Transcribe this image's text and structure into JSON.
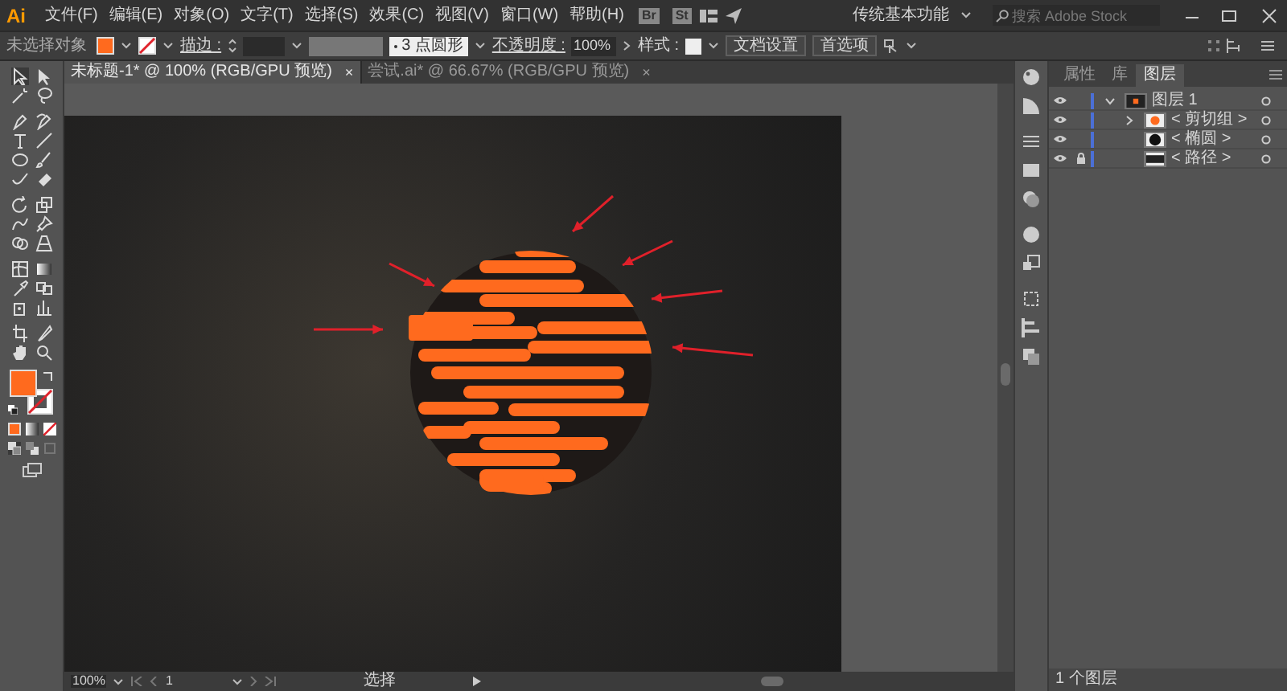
{
  "app": {
    "logo": "Ai",
    "menu": [
      "文件(F)",
      "编辑(E)",
      "对象(O)",
      "文字(T)",
      "选择(S)",
      "效果(C)",
      "视图(V)",
      "窗口(W)",
      "帮助(H)"
    ],
    "bridge_buttons": [
      "Br",
      "St"
    ],
    "workspace": "传统基本功能",
    "search": {
      "placeholder": "搜索 Adobe Stock"
    }
  },
  "control_bar": {
    "selection": "未选择对象",
    "stroke_label": "描边 :",
    "brush": "3 点圆形",
    "opacity_label": "不透明度 :",
    "opacity": "100%",
    "style_label": "样式 :",
    "buttons": [
      "文档设置",
      "首选项"
    ]
  },
  "document_tabs": [
    {
      "title": "未标题-1* @ 100% (RGB/GPU 预览)",
      "close": "×",
      "selected": true
    },
    {
      "title": "尝试.ai* @ 66.67% (RGB/GPU 预览)",
      "close": "×",
      "selected": false
    }
  ],
  "status_bar": {
    "zoom": "100%",
    "artboard": "1",
    "tool": "选择"
  },
  "panel": {
    "tabs": [
      {
        "label": "属性",
        "selected": false
      },
      {
        "label": "库",
        "selected": false
      },
      {
        "label": "图层",
        "selected": true
      }
    ],
    "layers": [
      {
        "name": "图层 1",
        "kind": "layer",
        "visible": true,
        "locked": false,
        "expanded": true,
        "children": [
          {
            "name": "< 剪切组 >",
            "kind": "clip_group",
            "visible": true,
            "locked": false,
            "expanded": false
          },
          {
            "name": "< 椭圆 >",
            "kind": "ellipse",
            "visible": true,
            "locked": false
          },
          {
            "name": "< 路径 >",
            "kind": "path",
            "visible": true,
            "locked": true
          }
        ]
      }
    ],
    "footer": "1 个图层"
  }
}
